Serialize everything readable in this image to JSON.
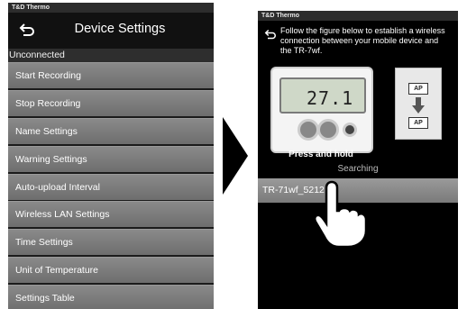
{
  "left_screen": {
    "status_bar": "T&D Thermo",
    "title": "Device Settings",
    "section_label": "Unconnected",
    "menu_items": [
      "Start Recording",
      "Stop Recording",
      "Name Settings",
      "Warning Settings",
      "Auto-upload Interval",
      "Wireless LAN Settings",
      "Time Settings",
      "Unit of Temperature",
      "Settings Table"
    ]
  },
  "right_screen": {
    "status_bar": "T&D Thermo",
    "instruction": "Follow the figure below to establish a wireless connection between your mobile device and the TR-7wf.",
    "device_display": "27.1",
    "press_label": "Press and hold",
    "ap_label": "AP",
    "searching_label": "Searching",
    "device_found": "TR-71wf_5212"
  },
  "icons": [
    "back-arrow-icon",
    "tap-hand-icon",
    "arrow-right-icon",
    "arrow-down-icon"
  ]
}
